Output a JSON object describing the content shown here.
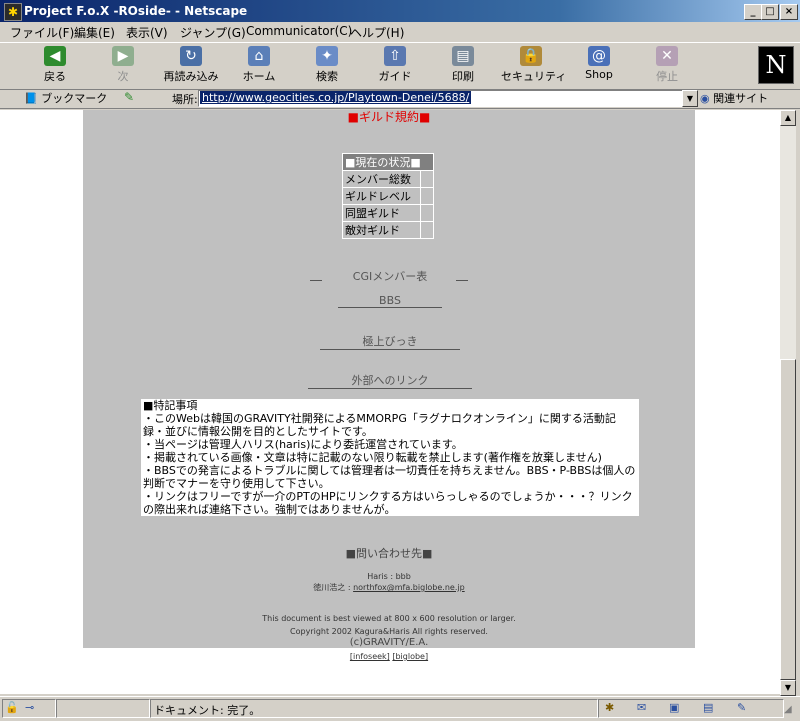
{
  "window": {
    "title": "Project F.o.X -ROside- - Netscape"
  },
  "menu": [
    "ファイル(F)",
    "編集(E)",
    "表示(V)",
    "ジャンプ(G)",
    "Communicator(C)",
    "ヘルプ(H)"
  ],
  "toolbar": {
    "back": "戻る",
    "forward": "次",
    "reload": "再読み込み",
    "home": "ホーム",
    "search": "検索",
    "guide": "ガイド",
    "print": "印刷",
    "security": "セキュリティ",
    "shop": "Shop",
    "stop": "停止"
  },
  "location": {
    "bookmarks": "ブックマーク",
    "label": "場所:",
    "url": "http://www.geocities.co.jp/Playtown-Denei/5688/",
    "related": "関連サイト"
  },
  "page": {
    "guild_rules": "■ギルド規約■",
    "status_table": {
      "header": "■現在の状況■",
      "rows": [
        "メンバー総数",
        "ギルドレベル",
        "同盟ギルド",
        "敵対ギルド"
      ]
    },
    "links": {
      "cgi_members": "CGIメンバー表",
      "bbs": "BBS",
      "gokujou": "極上びっき",
      "external": "外部へのリンク"
    },
    "notes": {
      "title": "■特記事項",
      "line1": "・このWebは韓国のGRAVITY社開発によるMMORPG「ラグナロクオンライン」に関する活動記録・並びに情報公開を目的としたサイトです。",
      "line2": "・当ページは管理人ハリス(haris)により委託運営されています。",
      "line3": "・掲載されている画像・文章は特に記載のない限り転載を禁止します(著作権を放棄しません)",
      "line4": "・BBSでの発言によるトラブルに関しては管理者は一切責任を持ちえません。BBS・P-BBSは個人の判断でマナーを守り使用して下さい。",
      "line5": "・リンクはフリーですが一介のPTのHPにリンクする方はいらっしゃるのでしょうか・・・？リンクの際出来れば連絡下さい。強制ではありませんが。"
    },
    "contact": {
      "heading": "■問い合わせ先■",
      "name": "Haris : bbb",
      "person": "徳川浩之 :",
      "email": "northfox@mfa.biglobe.ne.jp"
    },
    "footer": {
      "best_viewed": "This document is best viewed at 800 x 600 resolution or larger.",
      "copyright": "Copyright 2002 Kagura&Haris All rights reserved.",
      "gravity": "(c)GRAVITY/E.A.",
      "infoseek": "[infoseek]",
      "biglobe": "[biglobe]"
    }
  },
  "status": {
    "text": "ドキュメント: 完了。"
  }
}
